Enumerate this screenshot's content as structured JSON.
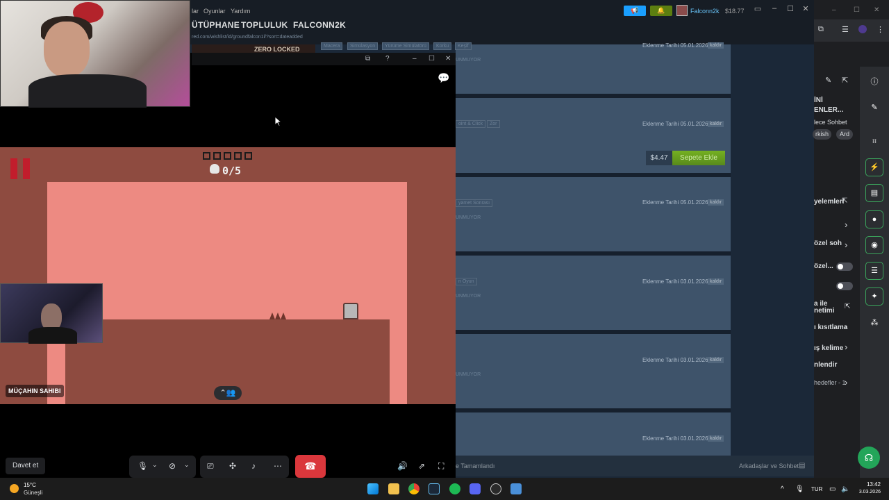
{
  "steam": {
    "menu": [
      "lar",
      "Oyunlar",
      "Yardım"
    ],
    "nav": [
      "ÜTÜPHANE",
      "TOPLULUK",
      "FALCONN2K"
    ],
    "url": "red.com/wishlist/id/groundfalcon1l/?sort=dateadded",
    "account_name": "Falconn2k",
    "wallet": "$18.77",
    "banner_text": "ZERO LOCKED",
    "rows": [
      {
        "tags": [
          "Macera",
          "Simülasyon",
          "Yürüme Simülatörü",
          "Korku",
          "Keşif"
        ],
        "added": "Eklenme Tarihi 05.01.2026",
        "remove": "kaldır",
        "status": "UNMUYOR"
      },
      {
        "tags": [
          "oint & Click",
          "Zor"
        ],
        "added": "Eklenme Tarihi 05.01.2026",
        "remove": "kaldır",
        "price": "$4.47",
        "cart": "Sepete Ekle"
      },
      {
        "tags": [
          "yamet Sonrası"
        ],
        "added": "Eklenme Tarihi 05.01.2026",
        "remove": "kaldır",
        "status": "UNMUYOR"
      },
      {
        "tags": [
          "n Oyun"
        ],
        "added": "Eklenme Tarihi 03.01.2026",
        "remove": "kaldır",
        "status": "UNMUYOR"
      },
      {
        "tags": [],
        "added": "Eklenme Tarihi 03.01.2026",
        "remove": "kaldır",
        "status": "UNMUYOR"
      },
      {
        "tags": [],
        "added": "Eklenme Tarihi 03.01.2026",
        "remove": "kaldır",
        "status": ""
      }
    ],
    "downloads": "e Tamamlandı",
    "friends": "Arkadaşlar ve Sohbet"
  },
  "discord_side": {
    "lines": [
      "İNİ",
      "ENLER...",
      "lece Sohbet",
      "rkish",
      "Ard",
      "yelemleri",
      "özel soh",
      "özel...",
      "a ile",
      "netimi",
      "ı kısıtlama",
      "ış kelime",
      "nlendir",
      "hedefler - 1"
    ]
  },
  "call": {
    "streamer_label": "MÜÇAHIN SAHIBI",
    "invite": "Davet et",
    "game": {
      "deaths": "0/5",
      "boxes_total": 5
    }
  },
  "taskbar": {
    "temp": "15°C",
    "condition": "Güneşli",
    "lang": "TUR",
    "time": "13:42",
    "date": "3.03.2026"
  },
  "colors": {
    "steam_bg": "#1b2838",
    "cart_green": "#75b022",
    "hangup": "#da373c",
    "game_wall": "#ed8a82",
    "game_bg": "#8e4b40"
  }
}
